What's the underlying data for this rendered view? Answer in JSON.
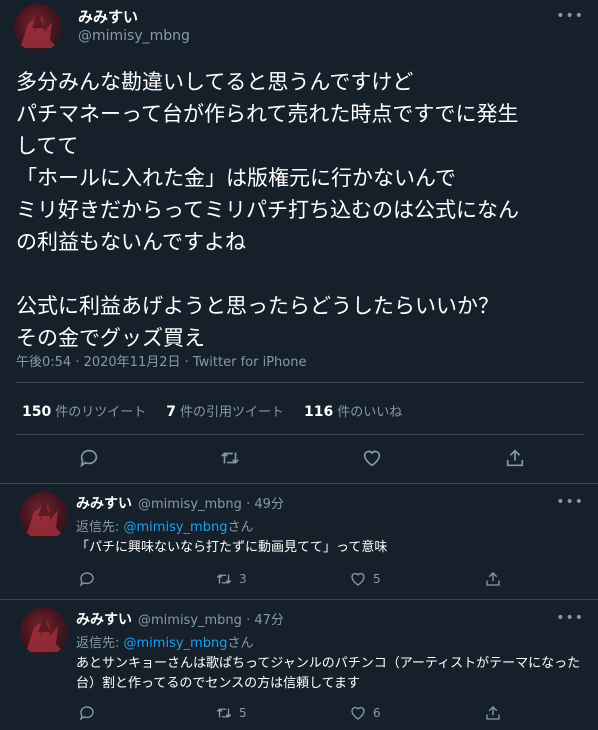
{
  "main_tweet": {
    "display_name": "みみすい",
    "handle": "@mimisy_mbng",
    "more_icon": "more-icon",
    "text": "多分みんな勘違いしてると思うんですけど\nパチマネーって台が作られて売れた時点ですでに発生\nしてて\n「ホールに入れた金」は版権元に行かないんで\nミリ好きだからってミリパチ打ち込むのは公式になん\nの利益もないんですよね\n\n公式に利益あげようと思ったらどうしたらいいか？\nその金でグッズ買え",
    "meta": "午後0:54 · 2020年11月2日 · Twitter for iPhone",
    "stats": {
      "retweets_count": "150",
      "retweets_label": "件のリツイート",
      "quotes_count": "7",
      "quotes_label": "件の引用ツイート",
      "likes_count": "116",
      "likes_label": "件のいいね"
    }
  },
  "replies": [
    {
      "display_name": "みみすい",
      "handle": "@mimisy_mbng",
      "time": "· 49分",
      "reply_prefix": "返信先: ",
      "reply_to": "@mimisy_mbng",
      "reply_suffix": "さん",
      "text": "「パチに興味ないなら打たずに動画見てて」って意味",
      "retweet_count": "3",
      "like_count": "5"
    },
    {
      "display_name": "みみすい",
      "handle": "@mimisy_mbng",
      "time": "· 47分",
      "reply_prefix": "返信先: ",
      "reply_to": "@mimisy_mbng",
      "reply_suffix": "さん",
      "text": "あとサンキョーさんは歌ぱちってジャンルのパチンコ（アーティストがテーマになった台）割と作ってるのでセンスの方は信頼してます",
      "retweet_count": "5",
      "like_count": "6"
    }
  ],
  "icons": {
    "reply": "reply-icon",
    "retweet": "retweet-icon",
    "like": "heart-icon",
    "share": "share-icon"
  },
  "colors": {
    "background": "#15202b",
    "muted": "#8899a6",
    "link": "#1da1f2",
    "divider": "#38444d"
  }
}
